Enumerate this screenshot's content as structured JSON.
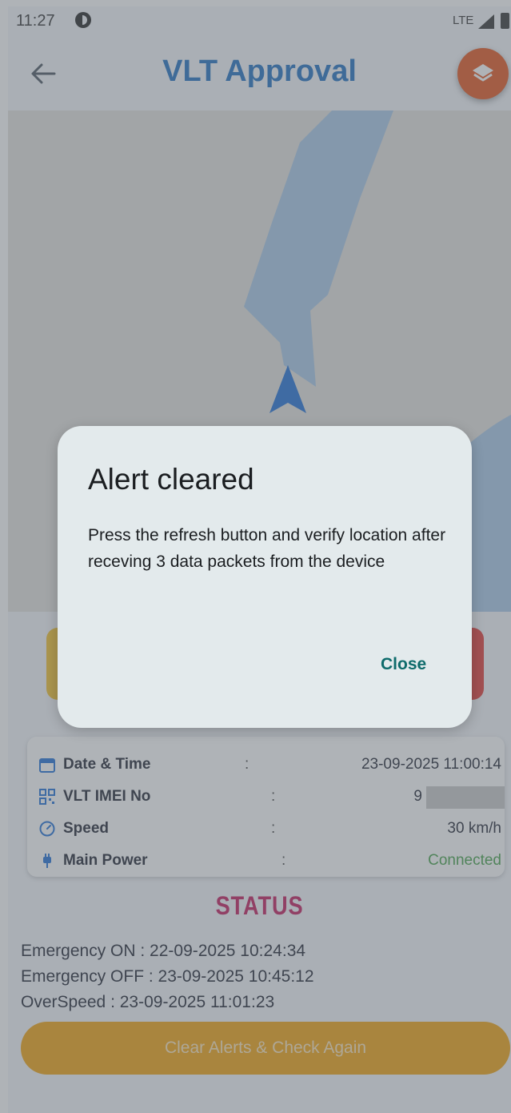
{
  "status_bar": {
    "time": "11:27",
    "network": "LTE"
  },
  "app_bar": {
    "title": "VLT Approval",
    "back_icon": "arrow-left-icon",
    "layers_icon": "layers-icon",
    "layers_color": "#e4531a"
  },
  "info": {
    "rows": [
      {
        "label": "Date & Time",
        "value": "23-09-2025 11:00:14",
        "icon": "calendar-icon"
      },
      {
        "label": "VLT IMEI No",
        "value": "9",
        "icon": "qr-code-icon"
      },
      {
        "label": "Speed",
        "value": "30 km/h",
        "icon": "speedometer-icon"
      },
      {
        "label": "Main Power",
        "value": "Connected",
        "icon": "power-plug-icon"
      }
    ],
    "separator": ":"
  },
  "status": {
    "heading": "STATUS",
    "lines": [
      "Emergency ON : 22-09-2025 10:24:34",
      "Emergency OFF : 23-09-2025 10:45:12",
      "OverSpeed : 23-09-2025 11:01:23"
    ]
  },
  "clear_button": {
    "label": "Clear Alerts & Check Again"
  },
  "dialog": {
    "title": "Alert cleared",
    "message": "Press the refresh button and verify location after receving 3 data packets from the device",
    "close_label": "Close"
  },
  "colors": {
    "title_blue": "#1f6fc0",
    "status_pink": "#c2185b",
    "connected_green": "#43a047",
    "clear_orange": "#f2a20c"
  }
}
